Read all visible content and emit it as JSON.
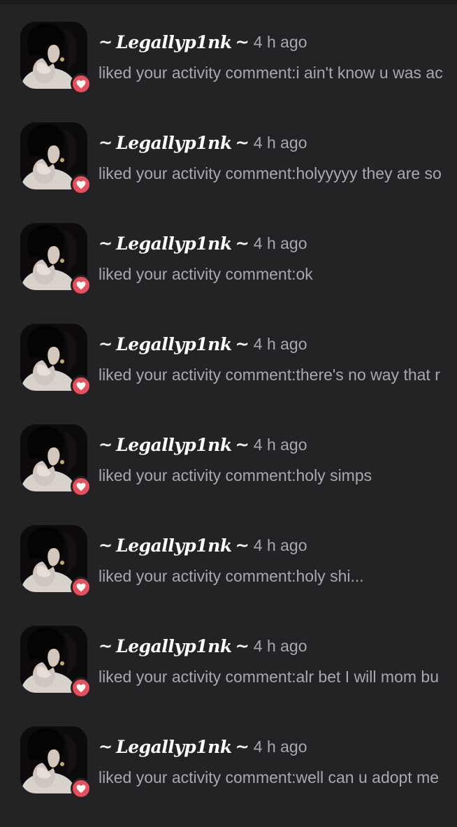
{
  "notifications": [
    {
      "username": "Legallyp1nk",
      "tilde_left": "~",
      "tilde_right": "~",
      "time": "4 h ago",
      "text": "liked your activity comment:i ain't know u was ac"
    },
    {
      "username": "Legallyp1nk",
      "tilde_left": "~",
      "tilde_right": "~",
      "time": "4 h ago",
      "text": "liked your activity comment:holyyyyy they are so"
    },
    {
      "username": "Legallyp1nk",
      "tilde_left": "~",
      "tilde_right": "~",
      "time": "4 h ago",
      "text": "liked your activity comment:ok"
    },
    {
      "username": "Legallyp1nk",
      "tilde_left": "~",
      "tilde_right": "~",
      "time": "4 h ago",
      "text": "liked your activity comment:there's no way that r"
    },
    {
      "username": "Legallyp1nk",
      "tilde_left": "~",
      "tilde_right": "~",
      "time": "4 h ago",
      "text": "liked your activity comment:holy simps"
    },
    {
      "username": "Legallyp1nk",
      "tilde_left": "~",
      "tilde_right": "~",
      "time": "4 h ago",
      "text": "liked your activity comment:holy shi..."
    },
    {
      "username": "Legallyp1nk",
      "tilde_left": "~",
      "tilde_right": "~",
      "time": "4 h ago",
      "text": "liked your activity comment:alr bet I will mom bu"
    },
    {
      "username": "Legallyp1nk",
      "tilde_left": "~",
      "tilde_right": "~",
      "time": "4 h ago",
      "text": "liked your activity comment:well can u adopt me"
    }
  ],
  "icons": {
    "avatar": "user-avatar-photo",
    "badge": "heart-icon"
  },
  "colors": {
    "background": "#232326",
    "badge": "#e8505d",
    "username": "#ffffff",
    "secondary_text": "#a9a9ad"
  }
}
